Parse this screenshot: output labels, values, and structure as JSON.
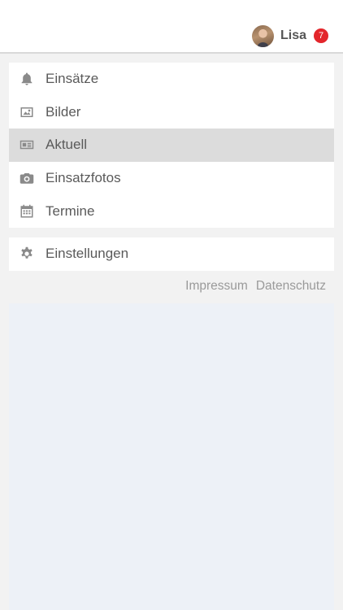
{
  "header": {
    "user_name": "Lisa",
    "notification_count": "7"
  },
  "menu": {
    "items": [
      {
        "label": "Einsätze",
        "icon": "bell-icon"
      },
      {
        "label": "Bilder",
        "icon": "image-icon"
      },
      {
        "label": "Aktuell",
        "icon": "newspaper-icon",
        "active": true
      },
      {
        "label": "Einsatzfotos",
        "icon": "camera-icon"
      },
      {
        "label": "Termine",
        "icon": "calendar-icon"
      }
    ]
  },
  "settings": {
    "label": "Einstellungen",
    "icon": "gear-icon"
  },
  "footer": {
    "impressum": "Impressum",
    "datenschutz": "Datenschutz"
  },
  "colors": {
    "badge": "#e3262b",
    "active_item": "#dcdcdc",
    "content_area": "#edf1f7"
  }
}
